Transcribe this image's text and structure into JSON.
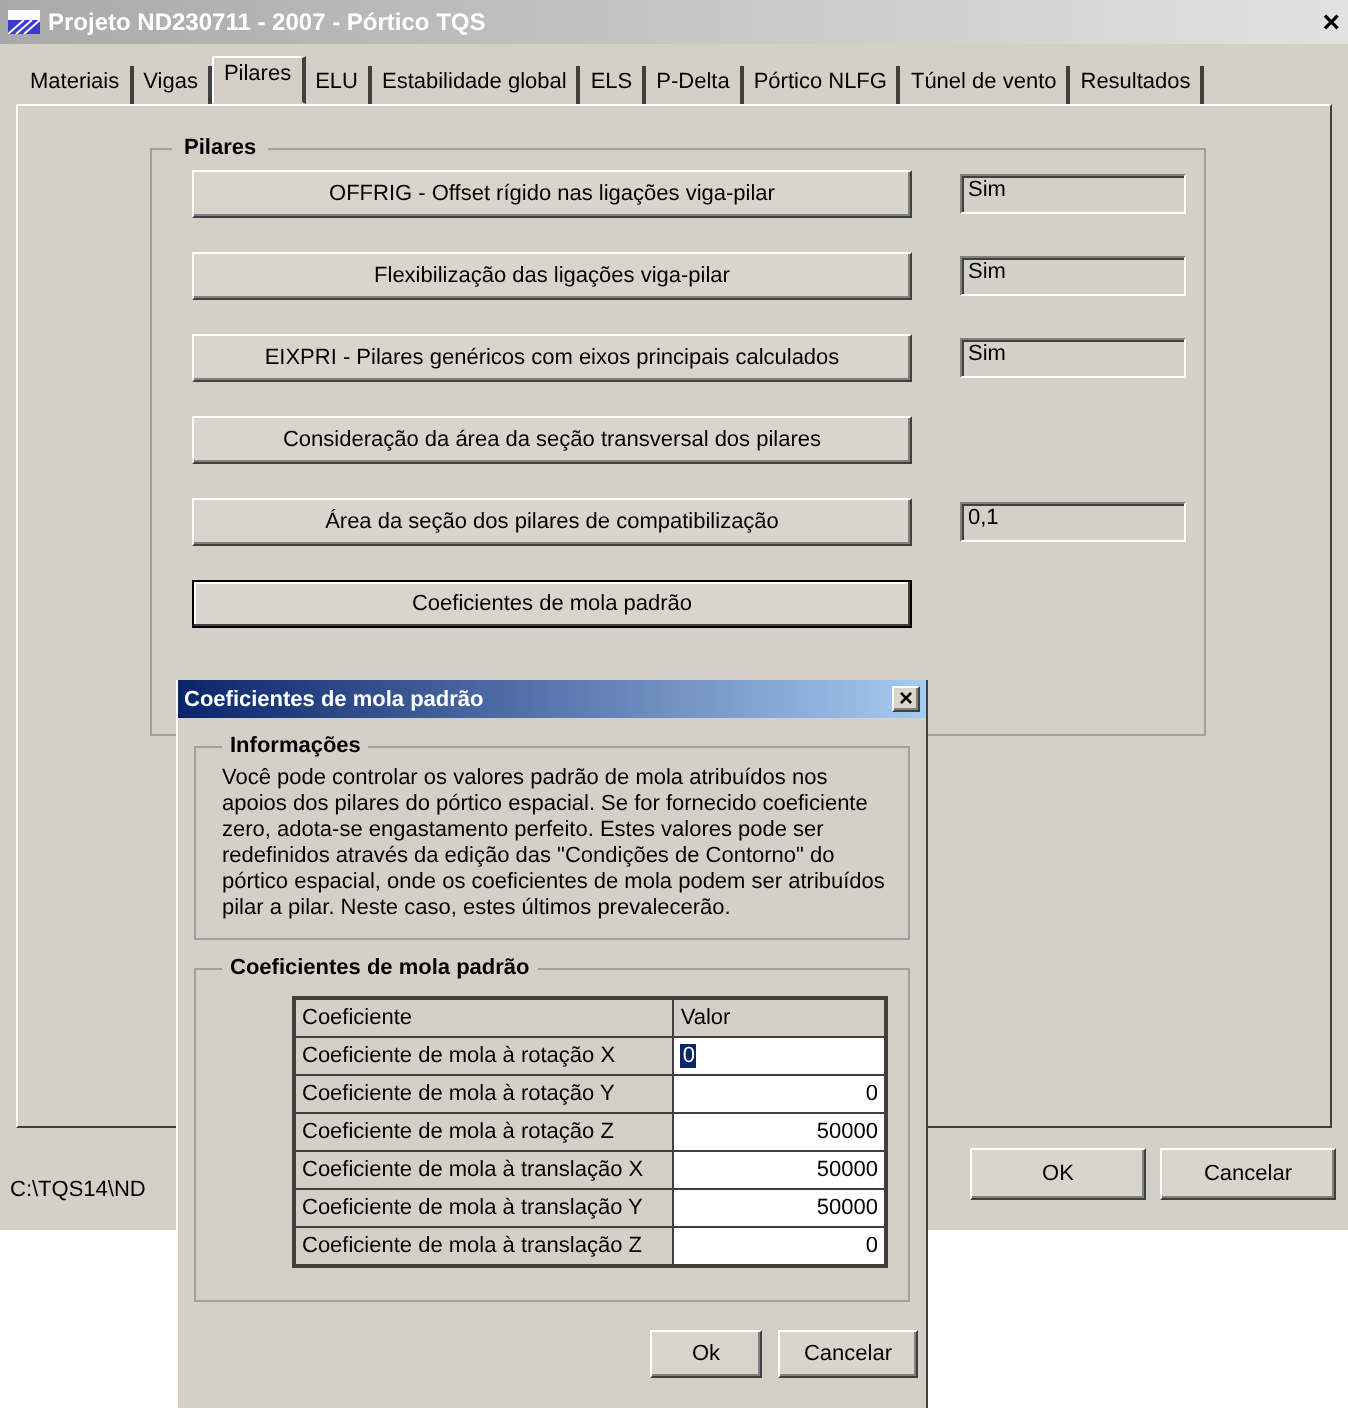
{
  "window": {
    "title": "Projeto ND230711 - 2007 - Pórtico TQS",
    "close": "×"
  },
  "tabs": [
    {
      "label": "Materiais",
      "selected": false
    },
    {
      "label": "Vigas",
      "selected": false
    },
    {
      "label": "Pilares",
      "selected": true
    },
    {
      "label": "ELU",
      "selected": false
    },
    {
      "label": "Estabilidade global",
      "selected": false
    },
    {
      "label": "ELS",
      "selected": false
    },
    {
      "label": "P-Delta",
      "selected": false
    },
    {
      "label": "Pórtico NLFG",
      "selected": false
    },
    {
      "label": "Túnel de vento",
      "selected": false
    },
    {
      "label": "Resultados",
      "selected": false
    }
  ],
  "group": {
    "title": "Pilares",
    "options": [
      {
        "button": "OFFRIG - Offset rígido nas ligações viga-pilar",
        "value": "Sim"
      },
      {
        "button": "Flexibilização das ligações viga-pilar",
        "value": "Sim"
      },
      {
        "button": "EIXPRI - Pilares genéricos com eixos principais calculados",
        "value": "Sim"
      },
      {
        "button": "Consideração da área da seção transversal dos pilares"
      },
      {
        "button": "Área da seção dos pilares de compatibilização",
        "value": "0,1"
      },
      {
        "button": "Coeficientes de mola padrão",
        "focused": true
      }
    ]
  },
  "status_bar": {
    "path": "C:\\TQS14\\ND"
  },
  "buttons": [
    "OK",
    "Cancelar"
  ],
  "dialog": {
    "title": "Coeficientes de mola padrão",
    "close": "×",
    "info": {
      "title": "Informações",
      "text": "Você pode controlar os valores padrão de mola atribuídos nos apoios dos pilares do pórtico espacial. Se for fornecido coeficiente zero, adota-se engastamento perfeito. Estes valores pode ser redefinidos através da edição das \"Condições de Contorno\" do pórtico espacial, onde os coeficientes de mola podem ser atribuídos pilar a pilar. Neste caso, estes últimos prevalecerão."
    },
    "table": {
      "title": "Coeficientes de mola padrão",
      "columns": [
        "Coeficiente",
        "Valor"
      ],
      "rows": [
        {
          "name": "Coeficiente de mola à rotação X",
          "value": "0",
          "editing": true
        },
        {
          "name": "Coeficiente de mola à rotação Y",
          "value": "0",
          "editing": false
        },
        {
          "name": "Coeficiente de mola à rotação Z",
          "value": "50000",
          "editing": false
        },
        {
          "name": "Coeficiente de mola à translação X",
          "value": "50000",
          "editing": false
        },
        {
          "name": "Coeficiente de mola à translação Y",
          "value": "50000",
          "editing": false
        },
        {
          "name": "Coeficiente de mola à translação Z",
          "value": "0",
          "editing": false
        }
      ]
    },
    "buttons": [
      "Ok",
      "Cancelar"
    ]
  }
}
